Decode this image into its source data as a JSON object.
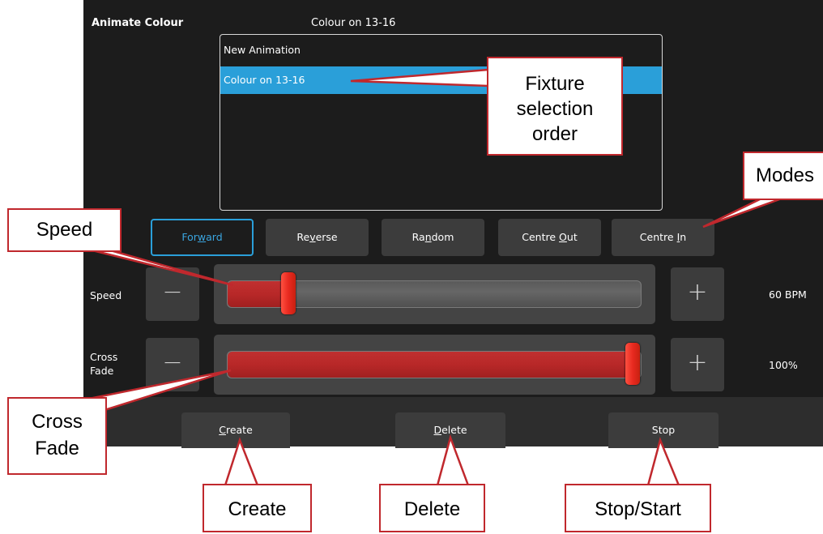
{
  "header": {
    "title": "Animate Colour",
    "current": "Colour on 13-16"
  },
  "animations": [
    {
      "label": "New Animation",
      "selected": false
    },
    {
      "label": "Colour on 13-16",
      "selected": true
    }
  ],
  "modes": [
    {
      "pre": "For",
      "key": "w",
      "post": "ard",
      "active": true
    },
    {
      "pre": "Re",
      "key": "v",
      "post": "erse",
      "active": false
    },
    {
      "pre": "Ra",
      "key": "n",
      "post": "dom",
      "active": false
    },
    {
      "pre": "Centre ",
      "key": "O",
      "post": "ut",
      "active": false
    },
    {
      "pre": "Centre ",
      "key": "I",
      "post": "n",
      "active": false
    }
  ],
  "speed": {
    "label": "Speed",
    "value_text": "60 BPM",
    "level_fraction": 0.13,
    "minus": "−",
    "plus": "+"
  },
  "crossfade": {
    "label_line1": "Cross",
    "label_line2": "Fade",
    "value_text": "100%",
    "level_fraction": 1.0,
    "minus": "−",
    "plus": "+"
  },
  "actions": {
    "create": {
      "key": "C",
      "rest": "reate"
    },
    "delete": {
      "key": "D",
      "rest": "elete"
    },
    "stop": {
      "label": "Stop"
    }
  },
  "callouts": {
    "fixture": {
      "line1": "Fixture",
      "line2": "selection",
      "line3": "order"
    },
    "modes": "Modes",
    "speed": "Speed",
    "crossfade": {
      "line1": "Cross",
      "line2": "Fade"
    },
    "create": "Create",
    "delete": "Delete",
    "stopstart": "Stop/Start"
  },
  "colors": {
    "panel": "#1c1c1c",
    "accent_blue": "#2a9fd9",
    "slider_red": "#d42a20",
    "callout_red": "#c0282d"
  }
}
